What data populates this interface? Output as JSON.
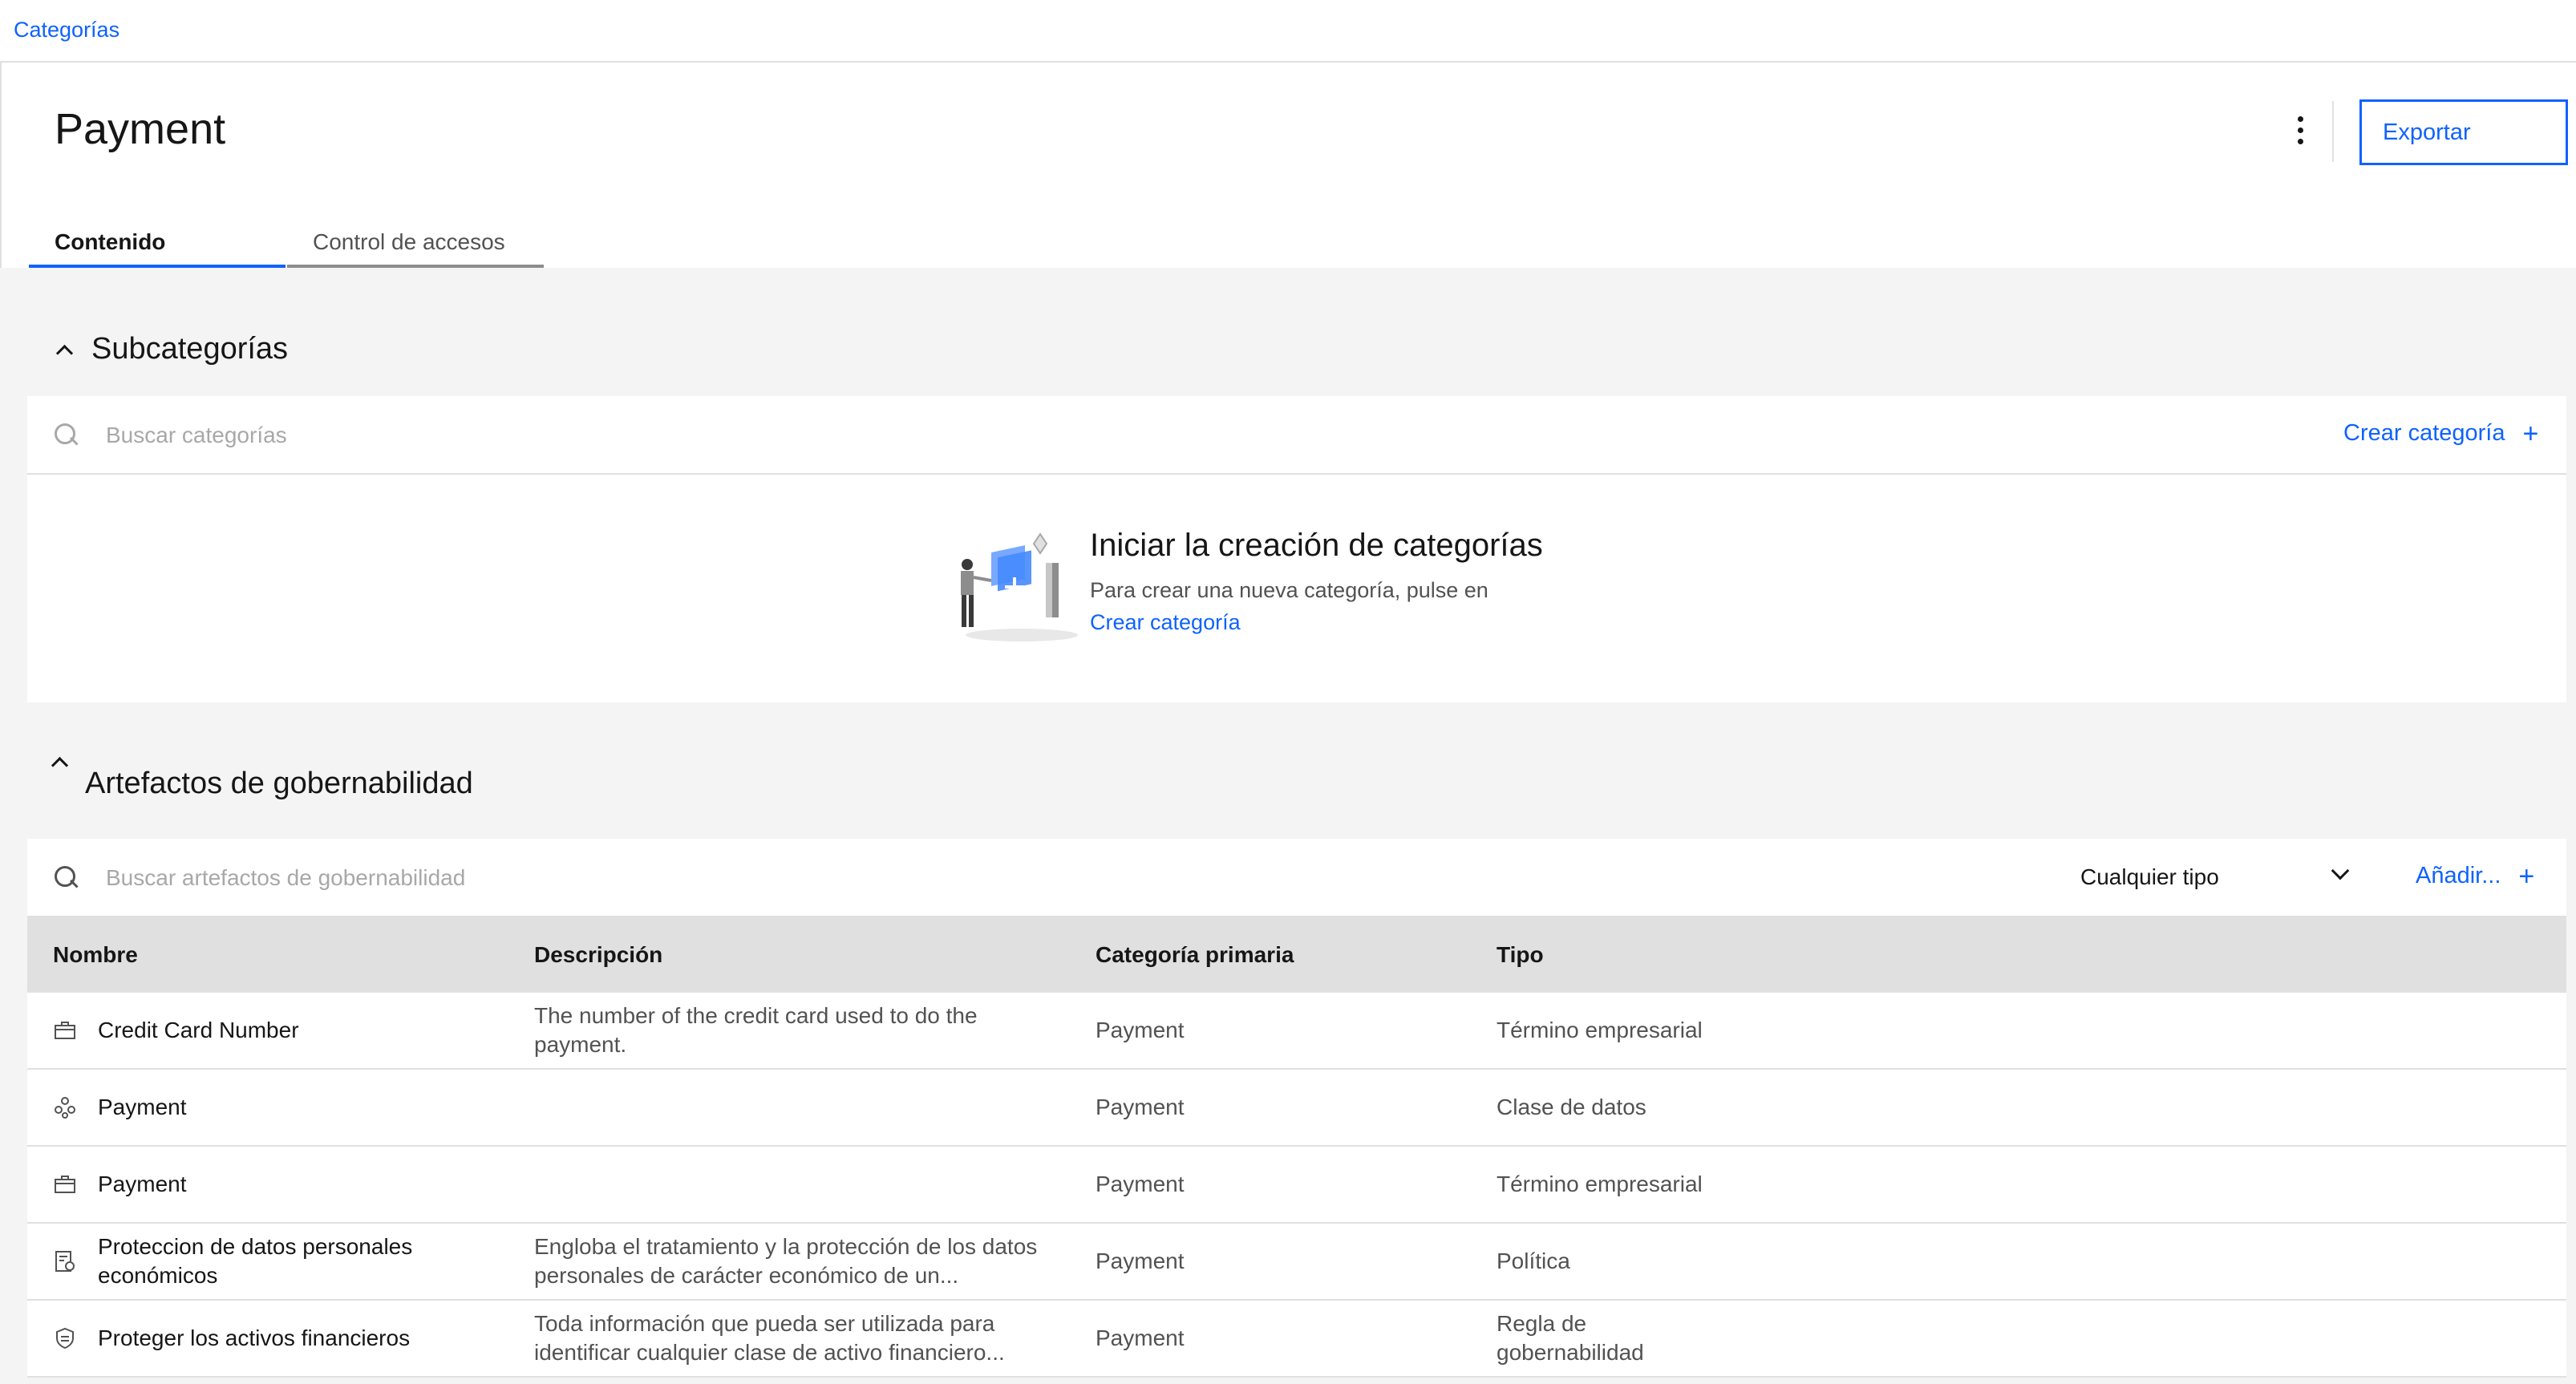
{
  "breadcrumb": {
    "label": "Categorías"
  },
  "header": {
    "title": "Payment",
    "export_label": "Exportar",
    "tabs": [
      {
        "label": "Contenido",
        "active": true
      },
      {
        "label": "Control de accesos",
        "active": false
      }
    ]
  },
  "subcategories": {
    "title": "Subcategorías",
    "search_placeholder": "Buscar categorías",
    "create_label": "Crear categoría",
    "empty": {
      "title": "Iniciar la creación de categorías",
      "text": "Para crear una nueva categoría, pulse en",
      "link": "Crear categoría"
    }
  },
  "artifacts": {
    "title": "Artefactos de gobernabilidad",
    "search_placeholder": "Buscar artefactos de gobernabilidad",
    "filter_value": "Cualquier tipo",
    "add_label": "Añadir...",
    "columns": [
      "Nombre",
      "Descripción",
      "Categoría primaria",
      "Tipo"
    ],
    "rows": [
      {
        "icon": "briefcase-icon",
        "name": "Credit Card Number",
        "description": "The number of the credit card used to do the payment.",
        "category": "Payment",
        "type": "Término empresarial"
      },
      {
        "icon": "data-class-icon",
        "name": "Payment",
        "description": "",
        "category": "Payment",
        "type": "Clase de datos"
      },
      {
        "icon": "briefcase-icon",
        "name": "Payment",
        "description": "",
        "category": "Payment",
        "type": "Término empresarial"
      },
      {
        "icon": "policy-icon",
        "name": "Proteccion de datos personales económicos",
        "description": "Engloba el tratamiento y la protección de los datos personales de carácter económico de un...",
        "category": "Payment",
        "type": "Política"
      },
      {
        "icon": "shield-icon",
        "name": "Proteger los activos financieros",
        "description": "Toda información que pueda ser utilizada para identificar cualquier clase de activo financiero...",
        "category": "Payment",
        "type": "Regla de gobernabilidad"
      }
    ]
  },
  "colors": {
    "accent": "#0f62fe",
    "background": "#f4f4f4",
    "header_row": "#e0e0e0"
  }
}
